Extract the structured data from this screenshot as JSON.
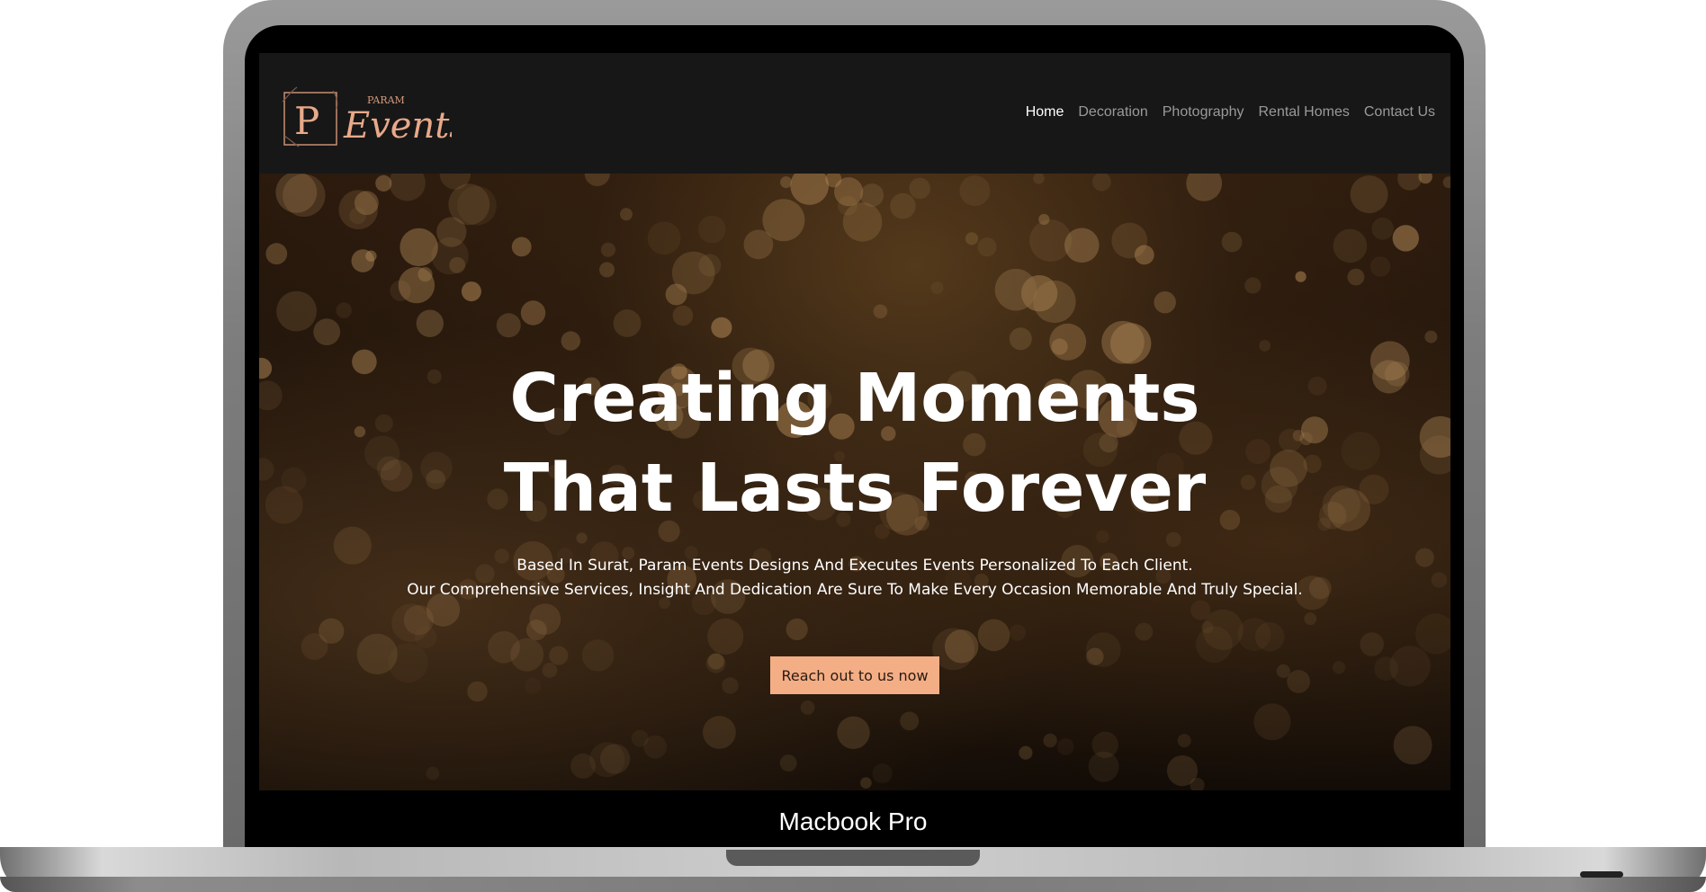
{
  "brand": {
    "logo_letter": "P",
    "logo_small": "PARAM",
    "logo_script": "Events",
    "accent_color": "#f4ae86"
  },
  "nav": {
    "items": [
      {
        "label": "Home",
        "active": true
      },
      {
        "label": "Decoration",
        "active": false
      },
      {
        "label": "Photography",
        "active": false
      },
      {
        "label": "Rental Homes",
        "active": false
      },
      {
        "label": "Contact Us",
        "active": false
      }
    ]
  },
  "hero": {
    "title_line1": "Creating Moments",
    "title_line2": "That Lasts Forever",
    "subtitle_line1": "Based In Surat, Param Events Designs And Executes Events Personalized To Each Client.",
    "subtitle_line2": "Our Comprehensive Services, Insight And Dedication Are Sure To Make Every Occasion Memorable And Truly Special.",
    "cta_label": "Reach out to us now"
  },
  "device": {
    "label": "Macbook Pro"
  }
}
